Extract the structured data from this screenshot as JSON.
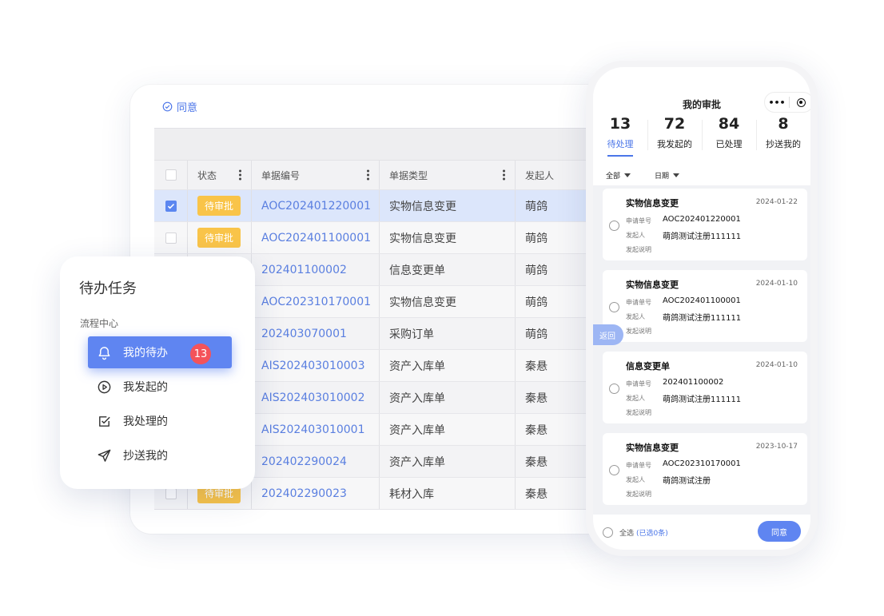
{
  "desktop": {
    "toolbar": {
      "approve_label": "同意"
    },
    "columns": [
      "状态",
      "单据编号",
      "单据类型",
      "发起人"
    ],
    "rows": [
      {
        "checked": true,
        "status": "待审批",
        "no": "AOC202401220001",
        "type": "实物信息变更",
        "initiator": "萌鸽"
      },
      {
        "checked": false,
        "status": "待审批",
        "no": "AOC202401100001",
        "type": "实物信息变更",
        "initiator": "萌鸽"
      },
      {
        "checked": false,
        "status": "",
        "no": "202401100002",
        "type": "信息变更单",
        "initiator": "萌鸽"
      },
      {
        "checked": false,
        "status": "",
        "no": "AOC202310170001",
        "type": "实物信息变更",
        "initiator": "萌鸽"
      },
      {
        "checked": false,
        "status": "",
        "no": "202403070001",
        "type": "采购订单",
        "initiator": "萌鸽"
      },
      {
        "checked": false,
        "status": "",
        "no": "AIS202403010003",
        "type": "资产入库单",
        "initiator": "秦悬"
      },
      {
        "checked": false,
        "status": "",
        "no": "AIS202403010002",
        "type": "资产入库单",
        "initiator": "秦悬"
      },
      {
        "checked": false,
        "status": "",
        "no": "AIS202403010001",
        "type": "资产入库单",
        "initiator": "秦悬"
      },
      {
        "checked": false,
        "status": "",
        "no": "202402290024",
        "type": "资产入库单",
        "initiator": "秦悬"
      },
      {
        "checked": false,
        "status": "待审批",
        "no": "202402290023",
        "type": "耗材入库",
        "initiator": "秦悬"
      }
    ]
  },
  "task": {
    "title": "待办任务",
    "section": "流程中心",
    "items": [
      {
        "label": "我的待办",
        "icon": "bell-icon",
        "badge": "13",
        "active": true
      },
      {
        "label": "我发起的",
        "icon": "play-circle-icon",
        "active": false
      },
      {
        "label": "我处理的",
        "icon": "checkbox-icon",
        "active": false
      },
      {
        "label": "抄送我的",
        "icon": "send-icon",
        "active": false
      }
    ]
  },
  "phone": {
    "title": "我的审批",
    "capsule_dots": "•••",
    "stats": [
      {
        "num": "13",
        "label": "待处理",
        "active": true
      },
      {
        "num": "72",
        "label": "我发起的",
        "active": false
      },
      {
        "num": "84",
        "label": "已处理",
        "active": false
      },
      {
        "num": "8",
        "label": "抄送我的",
        "active": false
      }
    ],
    "filters": [
      "全部",
      "日期"
    ],
    "field_labels": {
      "apply_no": "申请单号",
      "initiator": "发起人",
      "remark": "发起说明"
    },
    "cards": [
      {
        "title": "实物信息变更",
        "date": "2024-01-22",
        "no": "AOC202401220001",
        "initiator": "萌鸽测试注册111111"
      },
      {
        "title": "实物信息变更",
        "date": "2024-01-10",
        "no": "AOC202401100001",
        "initiator": "萌鸽测试注册111111"
      },
      {
        "title": "信息变更单",
        "date": "2024-01-10",
        "no": "202401100002",
        "initiator": "萌鸽测试注册111111"
      },
      {
        "title": "实物信息变更",
        "date": "2023-10-17",
        "no": "AOC202310170001",
        "initiator": "萌鸽测试注册"
      }
    ],
    "back_label": "返回",
    "footer": {
      "select_all": "全选",
      "selected_count": "(已选0条)",
      "approve_label": "同意"
    },
    "accent": "#5f85f1"
  }
}
